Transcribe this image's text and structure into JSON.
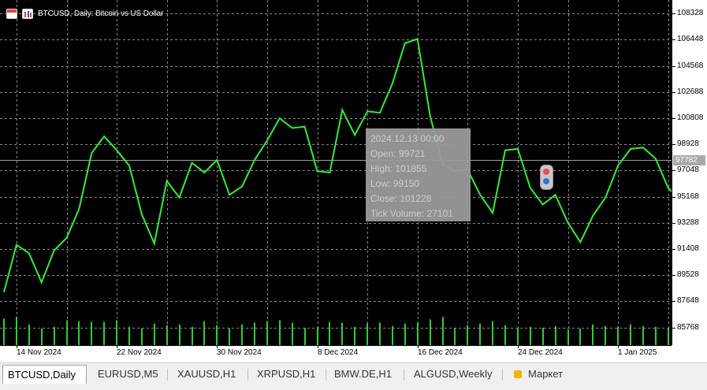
{
  "window": {
    "title": "BTCUSD, Daily:  Bitcoin vs US Dollar"
  },
  "icons": [
    "chart-window-icon",
    "chart-type-icon",
    "market-bag-icon"
  ],
  "colors": {
    "background": "#000000",
    "line": "#33ee33",
    "volume": "#33cc33",
    "grid": "#8a8a8a",
    "current_price_line": "#a0a0a0"
  },
  "tooltip": {
    "lines": [
      "2024.12.13 00:00",
      "Open: 99721",
      "High: 101855",
      "Low: 99150",
      "Close: 101228",
      "Tick Volume: 27101"
    ]
  },
  "price_axis": {
    "labels": [
      "108328",
      "106448",
      "104568",
      "102688",
      "100808",
      "98928",
      "97048",
      "95168",
      "93288",
      "91408",
      "89528",
      "87648",
      "85768"
    ],
    "current_price": "97782"
  },
  "time_axis": {
    "labels": [
      "14 Nov 2024",
      "22 Nov 2024",
      "30 Nov 2024",
      "8 Dec 2024",
      "16 Dec 2024",
      "24 Dec 2024",
      "1 Jan 2025"
    ]
  },
  "tabs": [
    {
      "label": "BTCUSD,Daily",
      "active": true
    },
    {
      "label": "EURUSD,M5",
      "active": false
    },
    {
      "label": "XAUUSD,H1",
      "active": false
    },
    {
      "label": "XRPUSD,H1",
      "active": false
    },
    {
      "label": "BMW.DE,H1",
      "active": false
    },
    {
      "label": "ALGUSD,Weekly",
      "active": false
    },
    {
      "label": "Маркет",
      "active": false
    }
  ],
  "chart_data": {
    "type": "line",
    "title": "BTCUSD, Daily:  Bitcoin vs US Dollar",
    "xlabel": "",
    "ylabel": "",
    "grid": true,
    "ylim": [
      84500,
      109300
    ],
    "x": [
      "2024-11-13",
      "2024-11-14",
      "2024-11-15",
      "2024-11-16",
      "2024-11-17",
      "2024-11-18",
      "2024-11-19",
      "2024-11-20",
      "2024-11-21",
      "2024-11-22",
      "2024-11-23",
      "2024-11-24",
      "2024-11-25",
      "2024-11-26",
      "2024-11-27",
      "2024-11-28",
      "2024-11-29",
      "2024-11-30",
      "2024-12-01",
      "2024-12-02",
      "2024-12-03",
      "2024-12-04",
      "2024-12-05",
      "2024-12-06",
      "2024-12-07",
      "2024-12-08",
      "2024-12-09",
      "2024-12-10",
      "2024-12-11",
      "2024-12-12",
      "2024-12-13",
      "2024-12-14",
      "2024-12-15",
      "2024-12-16",
      "2024-12-17",
      "2024-12-18",
      "2024-12-19",
      "2024-12-20",
      "2024-12-21",
      "2024-12-22",
      "2024-12-23",
      "2024-12-24",
      "2024-12-25",
      "2024-12-26",
      "2024-12-27",
      "2024-12-28",
      "2024-12-29",
      "2024-12-30",
      "2024-12-31",
      "2025-01-01",
      "2025-01-02",
      "2025-01-03",
      "2025-01-04",
      "2025-01-05",
      "2025-01-06"
    ],
    "series": [
      {
        "type": "line",
        "values": [
          88300,
          91700,
          91100,
          89000,
          91300,
          92200,
          94300,
          98300,
          99500,
          98500,
          97400,
          93900,
          91800,
          96300,
          95100,
          97600,
          96900,
          97800,
          95300,
          95900,
          97800,
          99200,
          100800,
          100100,
          100200,
          97000,
          96900,
          101400,
          99600,
          101300,
          101200,
          103300,
          106200,
          106500,
          101000,
          97500,
          97000,
          97100,
          95300,
          94000,
          98500,
          98600,
          95800,
          94600,
          95300,
          93300,
          91900,
          93800,
          95100,
          97400,
          98600,
          98700,
          97900,
          95800,
          94900
        ],
        "close_line_value": 97782
      },
      {
        "type": "volume",
        "values": [
          32000,
          34000,
          25000,
          20000,
          22000,
          30000,
          29000,
          28000,
          28000,
          30000,
          22000,
          20000,
          26000,
          24000,
          25000,
          22000,
          29000,
          24000,
          20000,
          25000,
          27000,
          29000,
          30000,
          27000,
          21000,
          22000,
          28000,
          27000,
          22000,
          26000,
          27101,
          23000,
          26000,
          27000,
          31000,
          34000,
          21000,
          24000,
          26000,
          29000,
          24000,
          21000,
          22000,
          21000,
          23000,
          19000,
          20000,
          25000,
          23000,
          22000,
          25000,
          23000,
          22000,
          21000,
          20000
        ]
      }
    ],
    "ylabels": [
      "108328",
      "106448",
      "104568",
      "102688",
      "100808",
      "98928",
      "97048",
      "95168",
      "93288",
      "91408",
      "89528",
      "87648",
      "85768"
    ],
    "xlabels": [
      "14 Nov 2024",
      "22 Nov 2024",
      "30 Nov 2024",
      "8 Dec 2024",
      "16 Dec 2024",
      "24 Dec 2024",
      "1 Jan 2025"
    ]
  }
}
